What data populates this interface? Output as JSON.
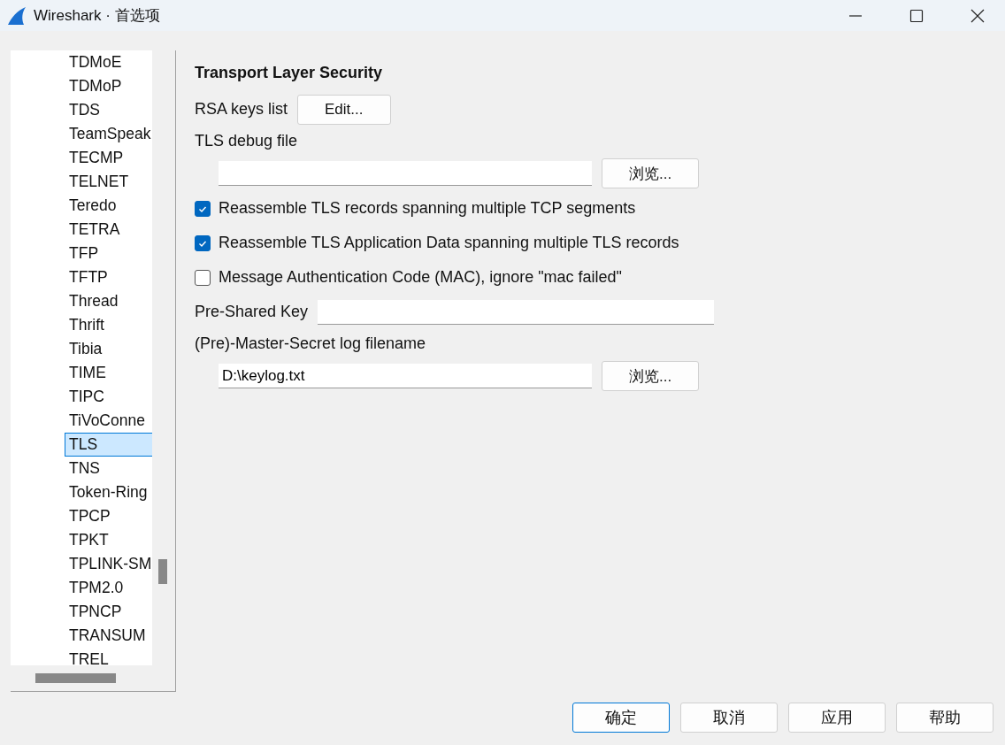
{
  "window": {
    "title": "Wireshark · 首选项"
  },
  "sidebar": {
    "items": [
      {
        "label": "TDMoE",
        "selected": false
      },
      {
        "label": "TDMoP",
        "selected": false
      },
      {
        "label": "TDS",
        "selected": false
      },
      {
        "label": "TeamSpeak",
        "selected": false
      },
      {
        "label": "TECMP",
        "selected": false
      },
      {
        "label": "TELNET",
        "selected": false
      },
      {
        "label": "Teredo",
        "selected": false
      },
      {
        "label": "TETRA",
        "selected": false
      },
      {
        "label": "TFP",
        "selected": false
      },
      {
        "label": "TFTP",
        "selected": false
      },
      {
        "label": "Thread",
        "selected": false
      },
      {
        "label": "Thrift",
        "selected": false
      },
      {
        "label": "Tibia",
        "selected": false
      },
      {
        "label": "TIME",
        "selected": false
      },
      {
        "label": "TIPC",
        "selected": false
      },
      {
        "label": "TiVoConne",
        "selected": false
      },
      {
        "label": "TLS",
        "selected": true
      },
      {
        "label": "TNS",
        "selected": false
      },
      {
        "label": "Token-Ring",
        "selected": false
      },
      {
        "label": "TPCP",
        "selected": false
      },
      {
        "label": "TPKT",
        "selected": false
      },
      {
        "label": "TPLINK-SM",
        "selected": false
      },
      {
        "label": "TPM2.0",
        "selected": false
      },
      {
        "label": "TPNCP",
        "selected": false
      },
      {
        "label": "TRANSUM",
        "selected": false
      },
      {
        "label": "TREL",
        "selected": false
      }
    ]
  },
  "panel": {
    "title": "Transport Layer Security",
    "rows": [
      {
        "kind": "label-button",
        "label": "RSA keys list",
        "button": "Edit..."
      },
      {
        "kind": "heading",
        "label": "TLS debug file"
      },
      {
        "kind": "file",
        "value": "",
        "button": "浏览..."
      },
      {
        "kind": "checkbox",
        "label": "Reassemble TLS records spanning multiple TCP segments",
        "checked": true
      },
      {
        "kind": "checkbox",
        "label": "Reassemble TLS Application Data spanning multiple TLS records",
        "checked": true
      },
      {
        "kind": "checkbox",
        "label": "Message Authentication Code (MAC), ignore \"mac failed\"",
        "checked": false
      },
      {
        "kind": "label-field",
        "label": "Pre-Shared Key",
        "value": ""
      },
      {
        "kind": "heading",
        "label": "(Pre)-Master-Secret log filename"
      },
      {
        "kind": "file",
        "value": "D:\\keylog.txt",
        "button": "浏览..."
      }
    ]
  },
  "buttons": [
    {
      "label": "确定",
      "default": true
    },
    {
      "label": "取消",
      "default": false
    },
    {
      "label": "应用",
      "default": false
    },
    {
      "label": "帮助",
      "default": false
    }
  ]
}
